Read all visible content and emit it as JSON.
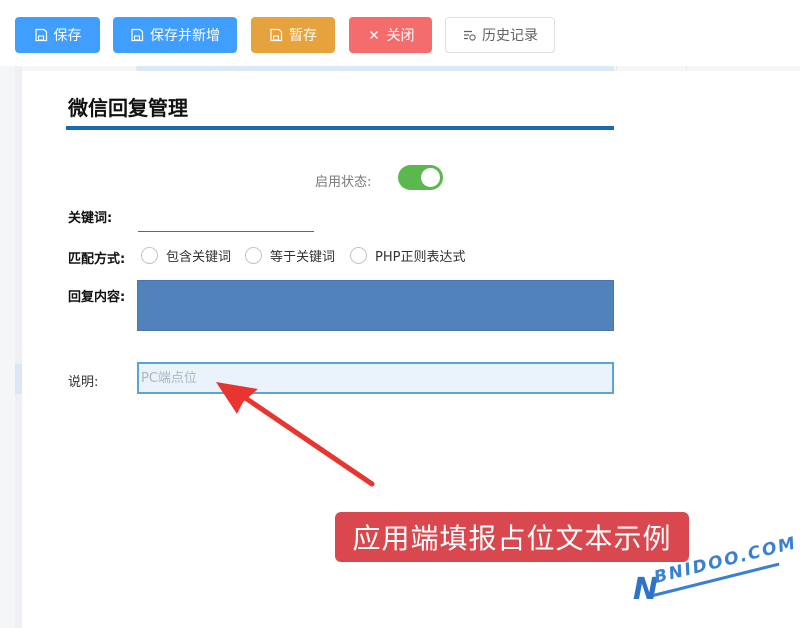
{
  "toolbar": {
    "save_label": "保存",
    "save_new_label": "保存并新增",
    "draft_label": "暂存",
    "close_label": "关闭",
    "history_label": "历史记录"
  },
  "page": {
    "title": "微信回复管理"
  },
  "form": {
    "status_label": "启用状态:",
    "status_enabled": true,
    "keyword_label": "关键词:",
    "keyword_value": "",
    "match_label": "匹配方式:",
    "match_options": [
      "包含关键词",
      "等于关键词",
      "PHP正则表达式"
    ],
    "reply_label": "回复内容:",
    "desc_label": "说明:",
    "desc_placeholder": "PC端点位"
  },
  "annotation": {
    "caption": "应用端填报占位文本示例"
  },
  "watermark": {
    "letter": "N",
    "text": "BNIDOO.COM"
  },
  "colors": {
    "primary": "#409eff",
    "warning": "#e6a23c",
    "danger": "#f56c6c",
    "toggle_on": "#5ab84f",
    "title_rule": "#1a6ab0",
    "reply_box": "#5182bc",
    "caption_bg": "#d8484e",
    "arrow": "#e8352f"
  }
}
